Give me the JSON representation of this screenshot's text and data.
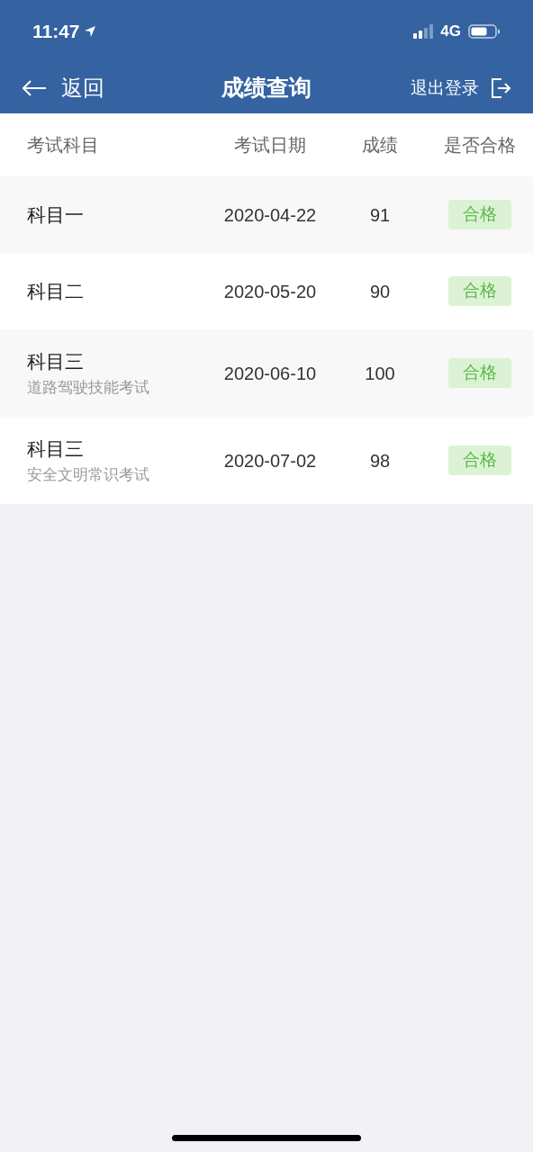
{
  "status_bar": {
    "time": "11:47",
    "network": "4G"
  },
  "nav": {
    "back": "返回",
    "title": "成绩查询",
    "logout": "退出登录"
  },
  "table": {
    "columns": [
      "考试科目",
      "考试日期",
      "成绩",
      "是否合格"
    ],
    "rows": [
      {
        "subject": "科目一",
        "date": "2020-04-22",
        "score": "91",
        "result": "合格"
      },
      {
        "subject": "科目二",
        "date": "2020-05-20",
        "score": "90",
        "result": "合格"
      },
      {
        "subject": "科目三",
        "note": "道路驾驶技能考试",
        "date": "2020-06-10",
        "score": "100",
        "result": "合格"
      },
      {
        "subject": "科目三",
        "note": "安全文明常识考试",
        "date": "2020-07-02",
        "score": "98",
        "result": "合格"
      }
    ]
  }
}
